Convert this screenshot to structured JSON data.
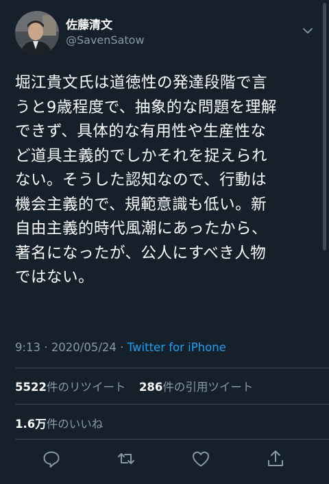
{
  "user": {
    "display_name": "佐藤清文",
    "handle": "@SavenSatow"
  },
  "tweet": {
    "lines": [
      "堀江貴文氏は道徳性の発達段階で言",
      "うと9歳程度で、抽象的な問題を理解",
      "できず、具体的な有用性や生産性な",
      "ど道具主義的でしかそれを捉えられ",
      "ない。そうした認知なので、行動は",
      "機会主義的で、規範意識も低い。新",
      "自由主義的時代風潮にあったから、",
      "著名になったが、公人にすべき人物",
      "ではない。"
    ],
    "time": "9:13",
    "separator": " · ",
    "date": "2020/05/24",
    "source": "Twitter for iPhone"
  },
  "stats": {
    "retweets": "5522",
    "retweets_label": "件のリツイート",
    "quotes": "286",
    "quotes_label": "件の引用ツイート",
    "likes": "1.6万",
    "likes_label": "件のいいね"
  },
  "colors": {
    "background": "#15202b",
    "text": "#ffffff",
    "secondary": "#8899a6",
    "link": "#1da1f2",
    "divider": "#38444d"
  },
  "icons": [
    "chevron-down-icon",
    "reply-icon",
    "retweet-icon",
    "like-icon",
    "share-icon"
  ]
}
